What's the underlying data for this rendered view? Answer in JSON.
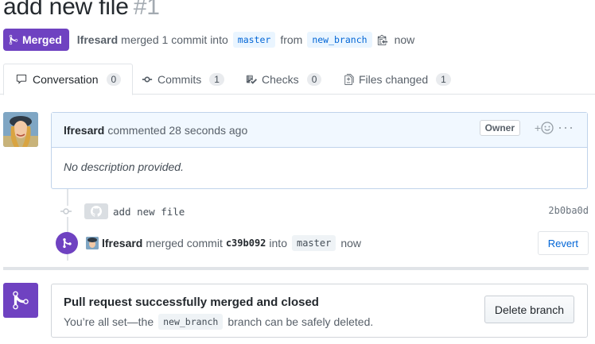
{
  "pr": {
    "title": "add new file",
    "number": "#1",
    "state_label": "Merged",
    "author": "lfresard",
    "merge_text": "merged 1 commit into",
    "base_branch": "master",
    "from_text": "from",
    "head_branch": "new_branch",
    "time": "now"
  },
  "tabs": [
    {
      "label": "Conversation",
      "count": "0",
      "icon": "comment-icon"
    },
    {
      "label": "Commits",
      "count": "1",
      "icon": "commit-icon"
    },
    {
      "label": "Checks",
      "count": "0",
      "icon": "checklist-icon"
    },
    {
      "label": "Files changed",
      "count": "1",
      "icon": "file-diff-icon"
    }
  ],
  "comment": {
    "author": "lfresard",
    "action": "commented 28 seconds ago",
    "role_badge": "Owner",
    "reaction_plus": "+",
    "body": "No description provided."
  },
  "commit": {
    "message": "add new file",
    "sha": "2b0ba0d"
  },
  "merge_event": {
    "author": "lfresard",
    "action": "merged commit",
    "sha": "c39b092",
    "into_text": "into",
    "branch": "master",
    "time": "now",
    "revert_label": "Revert"
  },
  "merged_box": {
    "title": "Pull request successfully merged and closed",
    "sub_prefix": "You’re all set—the",
    "branch": "new_branch",
    "sub_suffix": "branch can be safely deleted.",
    "delete_label": "Delete branch"
  },
  "colors": {
    "merged_purple": "#6f42c1",
    "link_blue": "#0366d6",
    "comment_header_bg": "#f1f8ff"
  }
}
